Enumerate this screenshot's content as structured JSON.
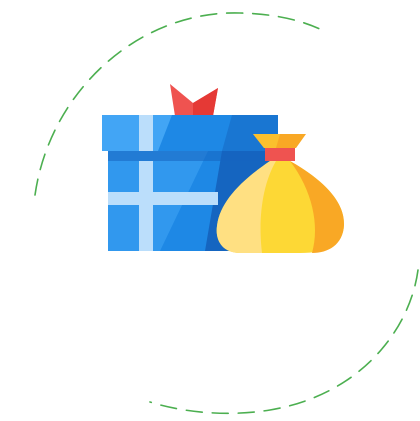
{
  "illustration": {
    "colors": {
      "ring_dash": "#4caf50",
      "box_blue_light": "#42a5f5",
      "box_blue": "#1e88e5",
      "box_blue_dark": "#1565c0",
      "ribbon": "#bbdefb",
      "bow": "#ef5350",
      "bag_yellow": "#fdd835",
      "bag_yellow_light": "#ffe082",
      "bag_yellow_dark": "#f9a825",
      "bag_tie": "#ef5350"
    },
    "icons": [
      "dashed-ring-icon",
      "gift-box-icon",
      "gift-bow-icon",
      "money-bag-icon"
    ]
  }
}
